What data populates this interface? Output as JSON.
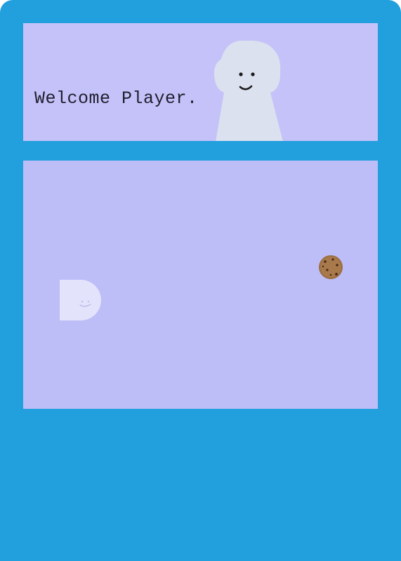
{
  "header": {
    "welcome_text": "Welcome Player."
  },
  "icons": {
    "npc": "ghost-character-icon",
    "player": "player-blob-icon",
    "cookie": "cookie-icon"
  },
  "colors": {
    "frame": "#229fdd",
    "panel": "#c4c2f8",
    "game_area": "#bdbdf8",
    "npc_body": "#dbe1ef",
    "player_body": "#e3e3fb",
    "cookie": "#9b6e3f"
  }
}
